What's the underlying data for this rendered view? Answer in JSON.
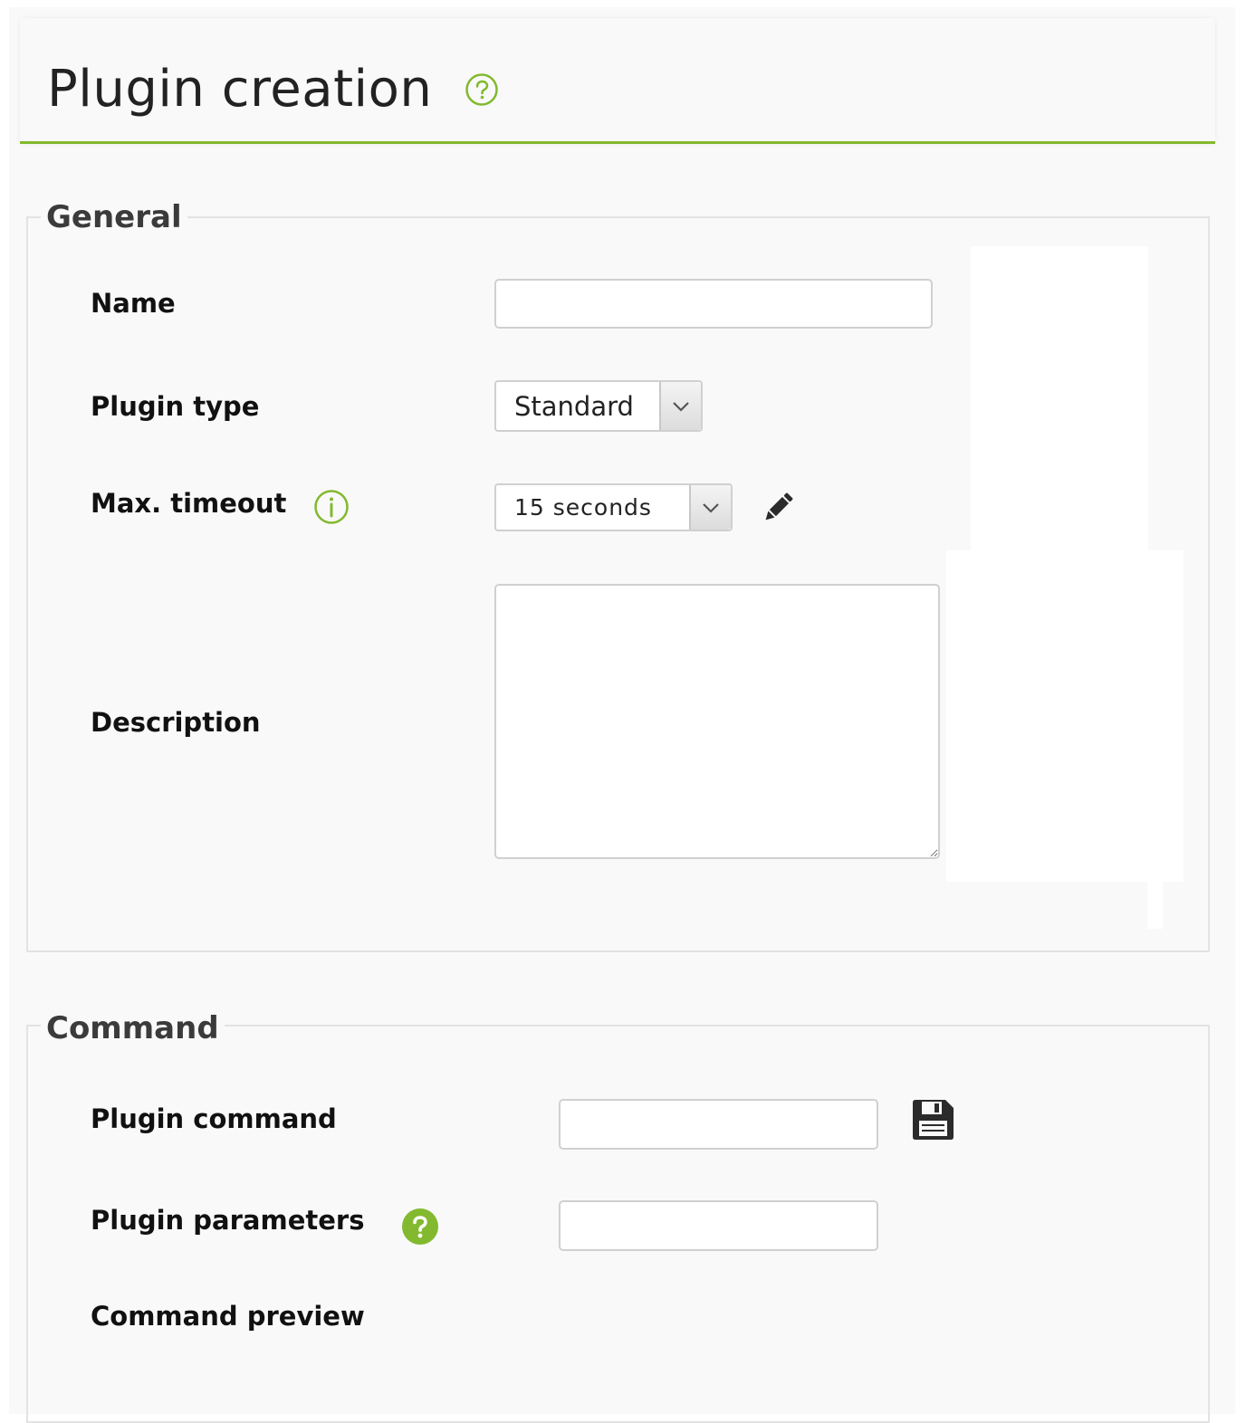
{
  "header": {
    "title": "Plugin creation",
    "help_icon": "question-circle-outline-icon"
  },
  "general": {
    "legend": "General",
    "name": {
      "label": "Name",
      "value": ""
    },
    "plugin_type": {
      "label": "Plugin type",
      "selected": "Standard"
    },
    "max_timeout": {
      "label": "Max. timeout",
      "selected": "15 seconds",
      "info_icon": "info-circle-icon",
      "edit_icon": "pencil-icon"
    },
    "description": {
      "label": "Description",
      "value": ""
    }
  },
  "command": {
    "legend": "Command",
    "plugin_command": {
      "label": "Plugin command",
      "value": "",
      "save_icon": "floppy-disk-icon"
    },
    "plugin_parameters": {
      "label": "Plugin parameters",
      "value": "",
      "help_icon": "question-circle-filled-icon"
    },
    "command_preview": {
      "label": "Command preview"
    }
  },
  "colors": {
    "accent": "#82b92e",
    "background": "#f9f9f9",
    "border": "#e3e3e3"
  }
}
